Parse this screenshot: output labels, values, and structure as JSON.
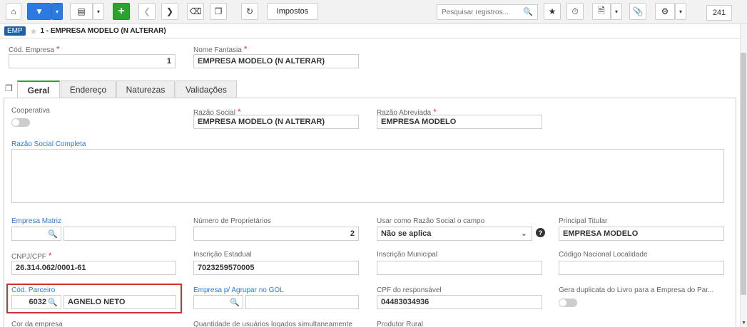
{
  "toolbar": {
    "impostos_label": "Impostos",
    "search_placeholder": "Pesquisar registros...",
    "record_count": "241"
  },
  "breadcrumb": {
    "badge": "EMP",
    "title": "1 - EMPRESA MODELO (N ALTERAR)"
  },
  "header_fields": {
    "cod_empresa_label": "Cód. Empresa",
    "cod_empresa_value": "1",
    "nome_fantasia_label": "Nome Fantasia",
    "nome_fantasia_value": "EMPRESA MODELO (N ALTERAR)"
  },
  "tabs": [
    "Geral",
    "Endereço",
    "Naturezas",
    "Validações"
  ],
  "form": {
    "cooperativa_label": "Cooperativa",
    "razao_social_label": "Razão Social",
    "razao_social_value": "EMPRESA MODELO (N ALTERAR)",
    "razao_abreviada_label": "Razão Abreviada",
    "razao_abreviada_value": "EMPRESA MODELO",
    "razao_social_completa_label": "Razão Social Completa",
    "empresa_matriz_label": "Empresa Matriz",
    "num_proprietarios_label": "Número de Proprietários",
    "num_proprietarios_value": "2",
    "usar_razao_label": "Usar como Razão Social o campo",
    "usar_razao_value": "Não se aplica",
    "principal_titular_label": "Principal Titular",
    "principal_titular_value": "EMPRESA MODELO",
    "cnpj_label": "CNPJ/CPF",
    "cnpj_value": "26.314.062/0001-61",
    "inscricao_estadual_label": "Inscrição Estadual",
    "inscricao_estadual_value": "7023259570005",
    "inscricao_municipal_label": "Inscrição Municipal",
    "codigo_nacional_label": "Código Nacional Localidade",
    "cod_parceiro_label": "Cód. Parceiro",
    "cod_parceiro_code": "6032",
    "cod_parceiro_name": "AGNELO NETO",
    "empresa_agrupar_label": "Empresa p/ Agrupar no GOL",
    "cpf_responsavel_label": "CPF do responsável",
    "cpf_responsavel_value": "04483034936",
    "gera_duplicata_label": "Gera duplicata do Livro para a Empresa do Par...",
    "cor_empresa_label": "Cor da empresa",
    "qtd_usuarios_label": "Quantidade de usuários logados simultaneamente",
    "produtor_rural_label": "Produtor Rural"
  }
}
